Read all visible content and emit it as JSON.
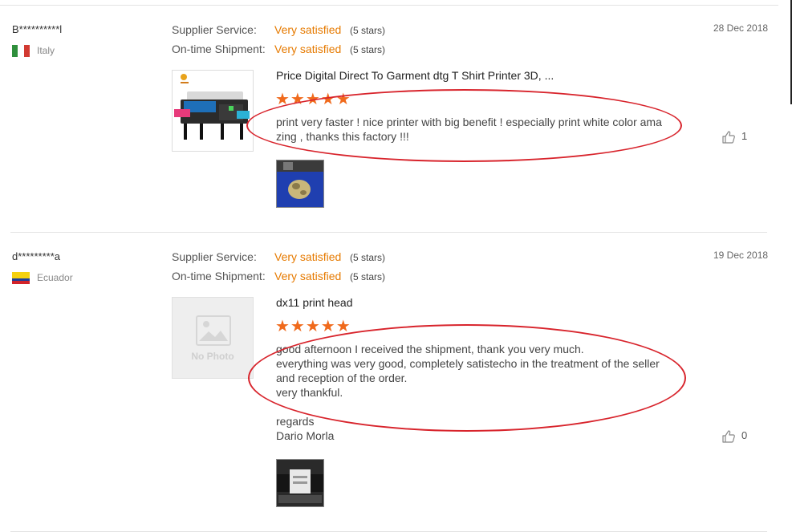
{
  "colors": {
    "accent": "#e67a00",
    "stars": "#f06a1c",
    "annotation": "#d8242c"
  },
  "reviews": [
    {
      "user": "B**********l",
      "country": "Italy",
      "flag_icon": "italy-flag-icon",
      "supplier_label": "Supplier Service:",
      "supplier_value": "Very satisfied",
      "supplier_stars": "(5 stars)",
      "shipment_label": "On-time Shipment:",
      "shipment_value": "Very satisfied",
      "shipment_stars": "(5 stars)",
      "date": "28 Dec 2018",
      "product_title": "Price Digital Direct To Garment dtg T Shirt Printer 3D, ...",
      "rating": 5,
      "rating_stars": "★★★★★",
      "text": "print very faster ! nice printer with big benefit ! especially print white color ama\nzing , thanks this factory !!!",
      "likes": "1"
    },
    {
      "user": "d*********a",
      "country": "Ecuador",
      "flag_icon": "ecuador-flag-icon",
      "supplier_label": "Supplier Service:",
      "supplier_value": "Very satisfied",
      "supplier_stars": "(5 stars)",
      "shipment_label": "On-time Shipment:",
      "shipment_value": "Very satisfied",
      "shipment_stars": "(5 stars)",
      "date": "19 Dec 2018",
      "product_title": "dx11 print head",
      "no_photo": "No Photo",
      "rating": 5,
      "rating_stars": "★★★★★",
      "text": "good afternoon I received the shipment, thank you very much.\neverything was very good, completely satistecho in the treatment of the seller\nand reception of the order.\nvery thankful.\n\nregards\nDario Morla",
      "likes": "0"
    }
  ]
}
